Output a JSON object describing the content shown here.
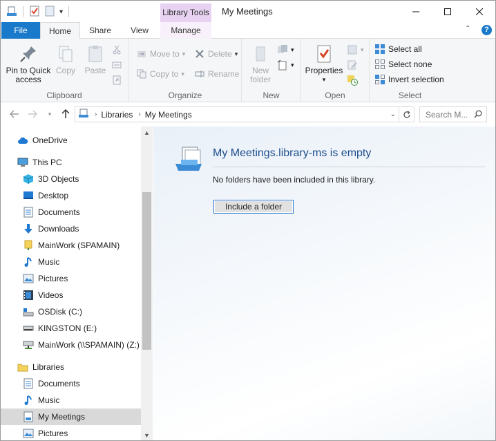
{
  "window": {
    "title": "My Meetings",
    "contextual_tab_group": "Library Tools",
    "controls": {
      "minimize": "—",
      "maximize": "☐",
      "close": "✕"
    }
  },
  "ribbon_tabs": {
    "file": "File",
    "home": "Home",
    "share": "Share",
    "view": "View",
    "manage": "Manage",
    "help": "?"
  },
  "ribbon": {
    "clipboard": {
      "label": "Clipboard",
      "pin": "Pin to Quick access",
      "copy": "Copy",
      "paste": "Paste"
    },
    "organize": {
      "label": "Organize",
      "move_to": "Move to",
      "copy_to": "Copy to",
      "delete": "Delete",
      "rename": "Rename"
    },
    "new": {
      "label": "New",
      "new_folder": "New folder"
    },
    "open": {
      "label": "Open",
      "properties": "Properties"
    },
    "select": {
      "label": "Select",
      "select_all": "Select all",
      "select_none": "Select none",
      "invert_selection": "Invert selection"
    }
  },
  "address": {
    "crumbs": [
      "Libraries",
      "My Meetings"
    ],
    "search_placeholder": "Search M..."
  },
  "nav_pane": {
    "items": [
      {
        "label": "OneDrive",
        "icon": "cloud-icon"
      },
      {
        "label": "This PC",
        "icon": "computer-icon"
      },
      {
        "label": "3D Objects",
        "icon": "cube-icon"
      },
      {
        "label": "Desktop",
        "icon": "desktop-icon"
      },
      {
        "label": "Documents",
        "icon": "documents-icon"
      },
      {
        "label": "Downloads",
        "icon": "download-arrow-icon"
      },
      {
        "label": "MainWork (SPAMAIN)",
        "icon": "network-folder-icon"
      },
      {
        "label": "Music",
        "icon": "music-note-icon"
      },
      {
        "label": "Pictures",
        "icon": "pictures-icon"
      },
      {
        "label": "Videos",
        "icon": "film-icon"
      },
      {
        "label": "OSDisk (C:)",
        "icon": "hard-drive-icon"
      },
      {
        "label": "KINGSTON (E:)",
        "icon": "usb-drive-icon"
      },
      {
        "label": "MainWork (\\\\SPAMAIN) (Z:)",
        "icon": "network-drive-icon"
      },
      {
        "label": "Libraries",
        "icon": "libraries-icon"
      },
      {
        "label": "Documents",
        "icon": "documents-icon"
      },
      {
        "label": "Music",
        "icon": "music-note-icon"
      },
      {
        "label": "My Meetings",
        "icon": "library-icon"
      },
      {
        "label": "Pictures",
        "icon": "pictures-icon"
      }
    ]
  },
  "content": {
    "title": "My Meetings.library-ms is empty",
    "description": "No folders have been included in this library.",
    "include_button": "Include a folder"
  }
}
